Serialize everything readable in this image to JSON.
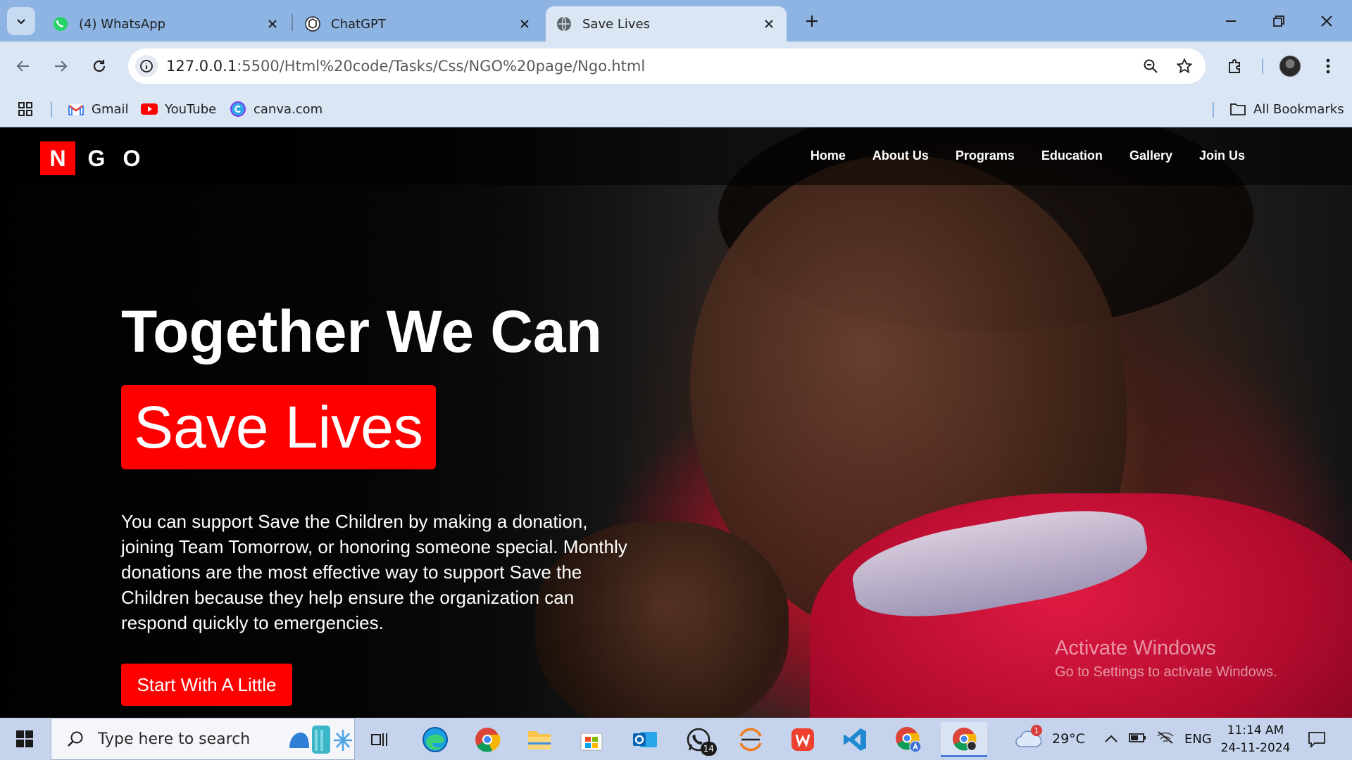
{
  "browser": {
    "tabs": [
      {
        "label": "(4) WhatsApp",
        "icon": "whatsapp-icon"
      },
      {
        "label": "ChatGPT",
        "icon": "chatgpt-icon"
      },
      {
        "label": "Save Lives",
        "icon": "globe-icon",
        "active": true
      }
    ],
    "url_host": "127.0.0.1",
    "url_rest": ":5500/Html%20code/Tasks/Css/NGO%20page/Ngo.html",
    "bookmarks": [
      {
        "label": "Gmail",
        "icon": "gmail-icon"
      },
      {
        "label": "YouTube",
        "icon": "youtube-icon"
      },
      {
        "label": "canva.com",
        "icon": "canva-icon"
      }
    ],
    "all_bookmarks_label": "All Bookmarks"
  },
  "site": {
    "logo_letters": [
      "N",
      "G",
      "O"
    ],
    "nav": [
      "Home",
      "About Us",
      "Programs",
      "Education",
      "Gallery",
      "Join Us"
    ],
    "hero_title": "Together We Can",
    "hero_highlight": "Save Lives",
    "hero_text": "You can support Save the Children by making a donation, joining Team Tomorrow, or honoring someone special. Monthly donations are the most effective way to support Save the Children because they help ensure the organization can respond quickly to emergencies.",
    "cta_label": "Start With A Little",
    "accent_color": "#ff0000"
  },
  "watermark": {
    "title": "Activate Windows",
    "subtitle": "Go to Settings to activate Windows."
  },
  "taskbar": {
    "search_placeholder": "Type here to search",
    "apps": [
      "task-view",
      "edge",
      "chrome",
      "file-explorer",
      "microsoft-store",
      "outlook",
      "whatsapp",
      "app-orange",
      "wps-office",
      "vscode",
      "chrome-profile-a",
      "chrome-active"
    ],
    "whatsapp_badge": "14",
    "weather_temp": "29°C",
    "weather_alert_count": "1",
    "language": "ENG",
    "time": "11:14 AM",
    "date": "24-11-2024"
  }
}
